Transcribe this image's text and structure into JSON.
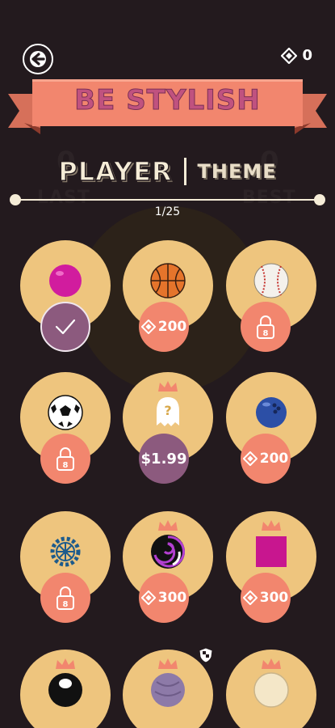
{
  "header": {
    "gems": "0",
    "title": "BE STYLISH"
  },
  "tabs": {
    "player": "PLAYER",
    "theme": "THEME"
  },
  "scores": {
    "last_label": "LAST",
    "best_label": "BEST",
    "last_value": "0",
    "best_value": "0"
  },
  "pagination": {
    "indicator": "1/25"
  },
  "colors": {
    "background": "#231a1e",
    "disc": "#eec57e",
    "badge": "#f2866e",
    "selected": "#8c5a7e",
    "banner": "#f2866e",
    "title": "#c0527f"
  },
  "items": [
    {
      "name": "pink-ball-icon",
      "state": "selected"
    },
    {
      "name": "basketball-icon",
      "state": "gems",
      "cost": "200"
    },
    {
      "name": "baseball-icon",
      "state": "locked"
    },
    {
      "name": "soccer-ball-icon",
      "state": "locked"
    },
    {
      "name": "mystery-ghost-icon",
      "state": "price",
      "cost": "$1.99",
      "crown": true
    },
    {
      "name": "bowling-ball-icon",
      "state": "gems",
      "cost": "200"
    },
    {
      "name": "gear-wheel-icon",
      "state": "locked"
    },
    {
      "name": "swirl-ball-icon",
      "state": "gems",
      "cost": "300",
      "crown": true
    },
    {
      "name": "magenta-square-icon",
      "state": "gems",
      "cost": "300",
      "crown": true
    },
    {
      "name": "eight-ball-icon",
      "state": "hidden",
      "crown": true
    },
    {
      "name": "purple-ball-icon",
      "state": "hidden",
      "crown": true
    },
    {
      "name": "cream-ball-icon",
      "state": "hidden",
      "crown": true
    }
  ]
}
